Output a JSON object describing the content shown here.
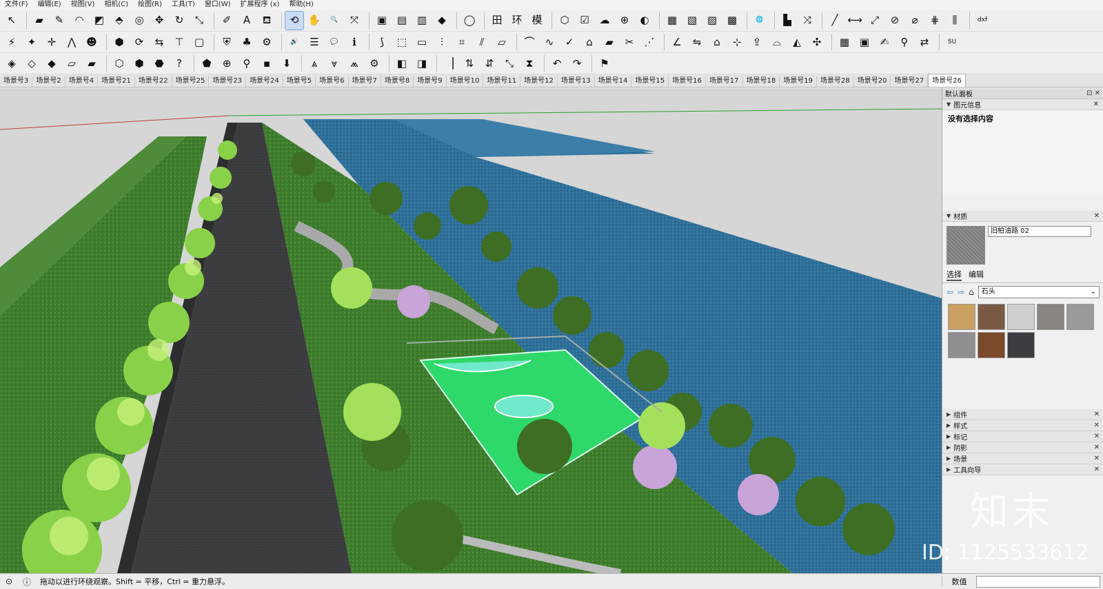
{
  "menu": [
    "文件(F)",
    "编辑(E)",
    "视图(V)",
    "相机(C)",
    "绘图(R)",
    "工具(T)",
    "窗口(W)",
    "扩展程序 (x)",
    "帮助(H)"
  ],
  "toolbar1": [
    {
      "icon": "select-arrow-icon",
      "glyph": "↖"
    },
    {
      "icon": "eraser-icon",
      "glyph": "▰"
    },
    {
      "icon": "pencil-icon",
      "glyph": "✎"
    },
    {
      "icon": "arc-icon",
      "glyph": "◠"
    },
    {
      "icon": "rectangle-icon",
      "glyph": "◩"
    },
    {
      "icon": "push-pull-icon",
      "glyph": "⬘"
    },
    {
      "icon": "offset-icon",
      "glyph": "◎"
    },
    {
      "icon": "move-icon",
      "glyph": "✥"
    },
    {
      "icon": "rotate-icon",
      "glyph": "↻"
    },
    {
      "icon": "scale-icon",
      "glyph": "⤡"
    },
    {
      "icon": "tape-measure-icon",
      "glyph": "✐"
    },
    {
      "icon": "text-icon",
      "glyph": "A"
    },
    {
      "icon": "paint-bucket-icon",
      "glyph": "⛾"
    },
    {
      "icon": "orbit-icon",
      "glyph": "⟲",
      "active": true
    },
    {
      "icon": "pan-icon",
      "glyph": "✋"
    },
    {
      "icon": "zoom-icon",
      "glyph": "🔍"
    },
    {
      "icon": "zoom-extents-icon",
      "glyph": "⤧"
    },
    {
      "icon": "warehouse-get-icon",
      "glyph": "▣"
    },
    {
      "icon": "warehouse-share-icon",
      "glyph": "▤"
    },
    {
      "icon": "model-share-icon",
      "glyph": "▥"
    },
    {
      "icon": "ruby-icon",
      "glyph": "◆"
    },
    {
      "icon": "account-icon",
      "glyph": "◯"
    },
    {
      "icon": "grid-icon",
      "glyph": "田"
    },
    {
      "icon": "environment-icon",
      "glyph": "环"
    },
    {
      "icon": "model-icon",
      "glyph": "模"
    },
    {
      "icon": "box-icon",
      "glyph": "⬡"
    },
    {
      "icon": "checklist-icon",
      "glyph": "☑"
    },
    {
      "icon": "cloud-upload-icon",
      "glyph": "☁"
    },
    {
      "icon": "add-location-icon",
      "glyph": "⊕"
    },
    {
      "icon": "trimble-icon",
      "glyph": "◐"
    },
    {
      "icon": "style-1-icon",
      "glyph": "▦"
    },
    {
      "icon": "style-2-icon",
      "glyph": "▧"
    },
    {
      "icon": "style-3-icon",
      "glyph": "▨"
    },
    {
      "icon": "style-4-icon",
      "glyph": "▩"
    },
    {
      "icon": "globe-icon",
      "glyph": "🌐"
    },
    {
      "icon": "color-palette-icon",
      "glyph": "▙"
    },
    {
      "icon": "transform-icon",
      "glyph": "⤨"
    },
    {
      "icon": "draw-line-icon",
      "glyph": "╱"
    },
    {
      "icon": "dimension-icon",
      "glyph": "⟷"
    },
    {
      "icon": "measure-icon",
      "glyph": "⤢"
    },
    {
      "icon": "hide-icon",
      "glyph": "⊘"
    },
    {
      "icon": "section-icon",
      "glyph": "⌀"
    },
    {
      "icon": "hatch-icon",
      "glyph": "⋕"
    },
    {
      "icon": "column-icon",
      "glyph": "⫼"
    },
    {
      "icon": "dxf-icon",
      "glyph": "dxf"
    }
  ],
  "toolbar2": [
    {
      "icon": "wand-icon",
      "glyph": "⚡"
    },
    {
      "icon": "sculpt-icon",
      "glyph": "✦"
    },
    {
      "icon": "axes-icon",
      "glyph": "✛"
    },
    {
      "icon": "roof-icon",
      "glyph": "⋀"
    },
    {
      "icon": "person-icon",
      "glyph": "☻"
    },
    {
      "icon": "component-icon",
      "glyph": "⬢"
    },
    {
      "icon": "sync-icon",
      "glyph": "⟳"
    },
    {
      "icon": "camera-path-icon",
      "glyph": "⇆"
    },
    {
      "icon": "paint-roller-icon",
      "glyph": "⊤"
    },
    {
      "icon": "photo-icon",
      "glyph": "▢"
    },
    {
      "icon": "shield-icon",
      "glyph": "⛨"
    },
    {
      "icon": "tree-icon",
      "glyph": "♣"
    },
    {
      "icon": "settings-icon",
      "glyph": "⚙"
    },
    {
      "icon": "speaker-icon",
      "glyph": "🔊"
    },
    {
      "icon": "slider-icon",
      "glyph": "☰"
    },
    {
      "icon": "chat-icon",
      "glyph": "💬"
    },
    {
      "icon": "info-icon",
      "glyph": "ℹ"
    },
    {
      "icon": "curve-1-icon",
      "glyph": "⟆"
    },
    {
      "icon": "cube-explode-icon",
      "glyph": "⬚"
    },
    {
      "icon": "frame-icon",
      "glyph": "▭"
    },
    {
      "icon": "fence-icon",
      "glyph": "⫶"
    },
    {
      "icon": "stairs-icon",
      "glyph": "⌗"
    },
    {
      "icon": "rails-icon",
      "glyph": "⫽"
    },
    {
      "icon": "layer-icon",
      "glyph": "▱"
    },
    {
      "icon": "curve-2-icon",
      "glyph": "⌒"
    },
    {
      "icon": "bezier-icon",
      "glyph": "∿"
    },
    {
      "icon": "check-curve-icon",
      "glyph": "✓"
    },
    {
      "icon": "roof-2-icon",
      "glyph": "⌂"
    },
    {
      "icon": "slab-icon",
      "glyph": "▰"
    },
    {
      "icon": "red-tool-icon",
      "glyph": "✂"
    },
    {
      "icon": "route-icon",
      "glyph": "⋰"
    },
    {
      "icon": "angle-icon",
      "glyph": "∠"
    },
    {
      "icon": "flip-icon",
      "glyph": "⇋"
    },
    {
      "icon": "house-icon",
      "glyph": "⌂"
    },
    {
      "icon": "compass-icon",
      "glyph": "⊹"
    },
    {
      "icon": "upload-icon",
      "glyph": "⇪"
    },
    {
      "icon": "extrude-icon",
      "glyph": "⌓"
    },
    {
      "icon": "solid-icon",
      "glyph": "◭"
    },
    {
      "icon": "explode-icon",
      "glyph": "✣"
    },
    {
      "icon": "texture-icon",
      "glyph": "▦"
    },
    {
      "icon": "image-icon",
      "glyph": "▣"
    },
    {
      "icon": "marker-icon",
      "glyph": "✍"
    },
    {
      "icon": "tube-icon",
      "glyph": "⚲"
    },
    {
      "icon": "mirror-icon",
      "glyph": "⇄"
    },
    {
      "icon": "su-app-icon",
      "glyph": "SU"
    }
  ],
  "toolbar3": [
    {
      "icon": "view-iso-icon",
      "glyph": "◈"
    },
    {
      "icon": "view-top-icon",
      "glyph": "◇"
    },
    {
      "icon": "view-front-icon",
      "glyph": "◆"
    },
    {
      "icon": "view-right-icon",
      "glyph": "▱"
    },
    {
      "icon": "view-back-icon",
      "glyph": "▰"
    },
    {
      "icon": "xray-icon",
      "glyph": "⬡"
    },
    {
      "icon": "wireframe-icon",
      "glyph": "⬢"
    },
    {
      "icon": "shaded-icon",
      "glyph": "⬣"
    },
    {
      "icon": "help-icon",
      "glyph": "?"
    },
    {
      "icon": "geo-shape-icon",
      "glyph": "⬟"
    },
    {
      "icon": "geo-location-icon",
      "glyph": "⊕"
    },
    {
      "icon": "person-pin-icon",
      "glyph": "⚲"
    },
    {
      "icon": "osm-icon",
      "glyph": "▪"
    },
    {
      "icon": "download-icon",
      "glyph": "⬇"
    },
    {
      "icon": "sandbox-1-icon",
      "glyph": "⩓"
    },
    {
      "icon": "sandbox-2-icon",
      "glyph": "⩔"
    },
    {
      "icon": "sandbox-3-icon",
      "glyph": "⩕"
    },
    {
      "icon": "gear-icon",
      "glyph": "⚙"
    },
    {
      "icon": "stamp-icon",
      "glyph": "◧"
    },
    {
      "icon": "drape-icon",
      "glyph": "◨"
    },
    {
      "icon": "smoove-icon",
      "glyph": "▕"
    },
    {
      "icon": "arrows-up-icon",
      "glyph": "⇅"
    },
    {
      "icon": "arrows-red-icon",
      "glyph": "⇵"
    },
    {
      "icon": "diagonal-icon",
      "glyph": "⤡"
    },
    {
      "icon": "flip-edge-icon",
      "glyph": "⧗"
    },
    {
      "icon": "undo-curve-icon",
      "glyph": "↶"
    },
    {
      "icon": "redo-curve-icon",
      "glyph": "↷"
    },
    {
      "icon": "flag-icon",
      "glyph": "⚑"
    }
  ],
  "scenes": [
    "场景号3",
    "场景号2",
    "场景号4",
    "场景号21",
    "场景号22",
    "场景号25",
    "场景号23",
    "场景号24",
    "场景号5",
    "场景号6",
    "场景号7",
    "场景号8",
    "场景号9",
    "场景号10",
    "场景号11",
    "场景号12",
    "场景号13",
    "场景号14",
    "场景号15",
    "场景号16",
    "场景号17",
    "场景号18",
    "场景号19",
    "场景号28",
    "场景号20",
    "场景号27",
    "场景号26"
  ],
  "active_scene": "场景号26",
  "panel": {
    "title": "默认面板",
    "entity_info": {
      "label": "图元信息",
      "body": "没有选择内容"
    },
    "materials": {
      "label": "材质",
      "name": "旧柏油路 02",
      "tabs": [
        "选择",
        "编辑"
      ],
      "active_tab": "选择",
      "library": "石头",
      "swatch_colors": [
        "#c9a060",
        "#7a5a45",
        "#cfcfcf",
        "#8a8580",
        "#9a9a9a",
        "#8f8f8f",
        "#7a4a2a",
        "#3a3c3f"
      ]
    },
    "sections": [
      "组件",
      "样式",
      "标记",
      "阴影",
      "场景",
      "工具向导"
    ]
  },
  "watermark": {
    "logo": "知末",
    "id": "ID: 1125533612"
  },
  "status": {
    "message": "拖动以进行环绕观察。Shift = 平移，Ctrl = 重力悬浮。",
    "measure_label": "数值"
  }
}
